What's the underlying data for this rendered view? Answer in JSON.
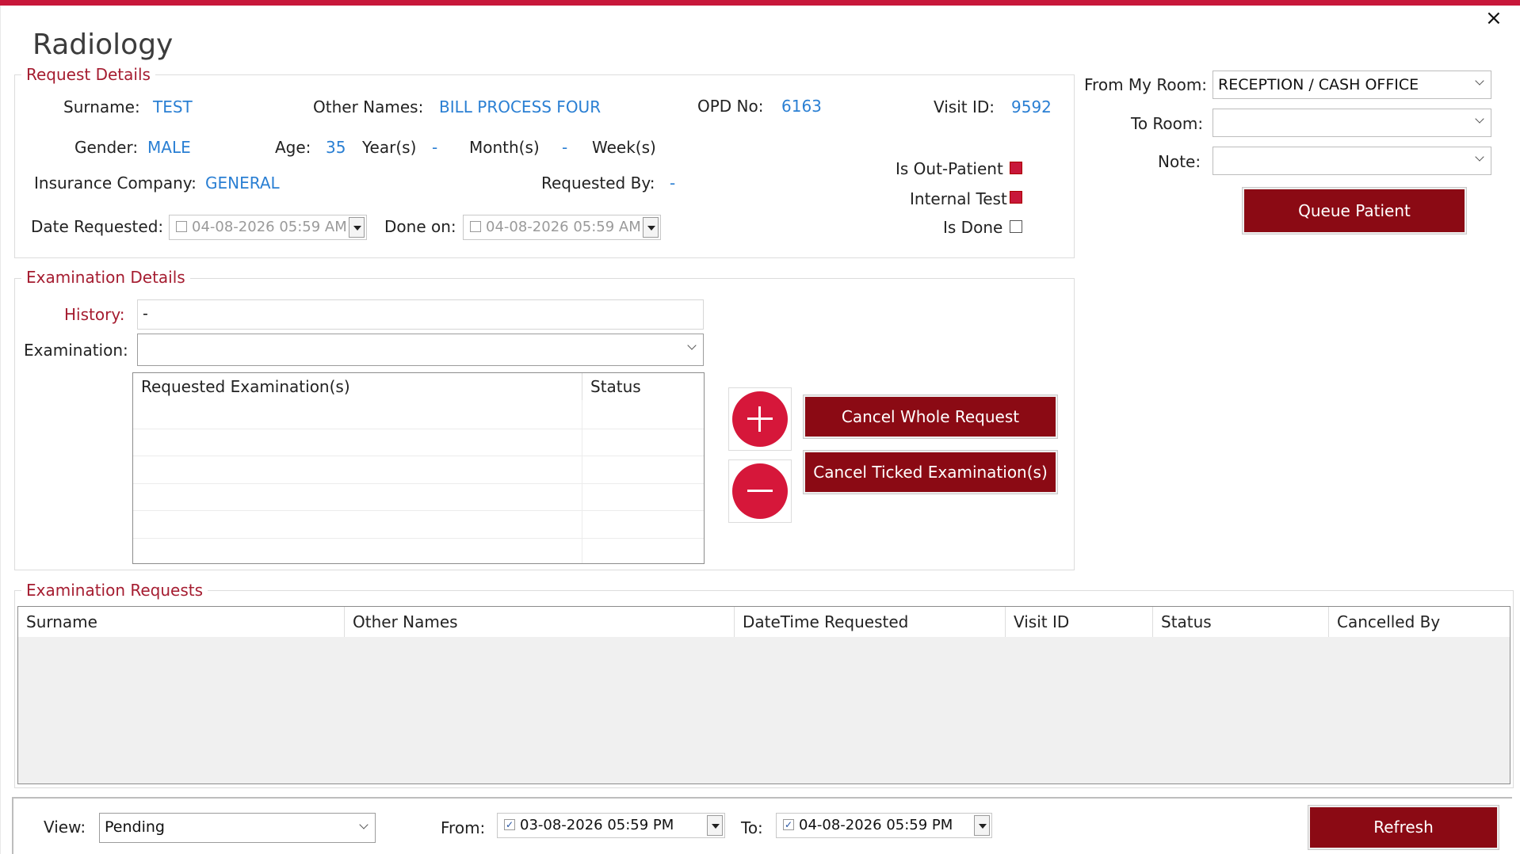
{
  "window": {
    "title": "Radiology",
    "close_icon": "×"
  },
  "request_details": {
    "group_title": "Request Details",
    "surname_label": "Surname:",
    "surname": "TEST",
    "other_names_label": "Other Names:",
    "other_names": "BILL PROCESS FOUR",
    "opd_label": "OPD No:",
    "opd": "6163",
    "visit_label": "Visit ID:",
    "visit": "9592",
    "gender_label": "Gender:",
    "gender": "MALE",
    "age_label": "Age:",
    "age": "35",
    "years_label": "Year(s)",
    "months_value": "-",
    "months_label": "Month(s)",
    "weeks_value": "-",
    "weeks_label": "Week(s)",
    "insurance_label": "Insurance Company:",
    "insurance": "GENERAL",
    "requested_by_label": "Requested By:",
    "requested_by": "-",
    "is_outpatient_label": "Is Out-Patient",
    "internal_test_label": "Internal Test",
    "is_done_label": "Is Done",
    "date_requested_label": "Date Requested:",
    "date_requested": "04-08-2026  05:59 AM",
    "done_on_label": "Done on:",
    "done_on": "04-08-2026  05:59 AM"
  },
  "routing": {
    "from_room_label": "From My Room:",
    "from_room": "RECEPTION / CASH OFFICE",
    "to_room_label": "To Room:",
    "to_room": "",
    "note_label": "Note:",
    "note": "",
    "queue_button": "Queue Patient"
  },
  "examination_details": {
    "group_title": "Examination Details",
    "history_label": "History:",
    "history": "-",
    "examination_label": "Examination:",
    "examination": "",
    "grid_headers": [
      "Requested Examination(s)",
      "Status"
    ],
    "cancel_whole": "Cancel Whole Request",
    "cancel_ticked": "Cancel Ticked Examination(s)"
  },
  "examination_requests": {
    "group_title": "Examination Requests",
    "headers": [
      "Surname",
      "Other Names",
      "DateTime Requested",
      "Visit ID",
      "Status",
      "Cancelled By"
    ]
  },
  "footer": {
    "view_label": "View:",
    "view_value": "Pending",
    "from_label": "From:",
    "from_value": "03-08-2026  05:59 PM",
    "to_label": "To:",
    "to_value": "04-08-2026  05:59 PM",
    "refresh_button": "Refresh"
  },
  "colors": {
    "accent": "#c8173a",
    "button": "#8b0a14",
    "link_value": "#2a7fd3",
    "group_title": "#a51c30"
  }
}
